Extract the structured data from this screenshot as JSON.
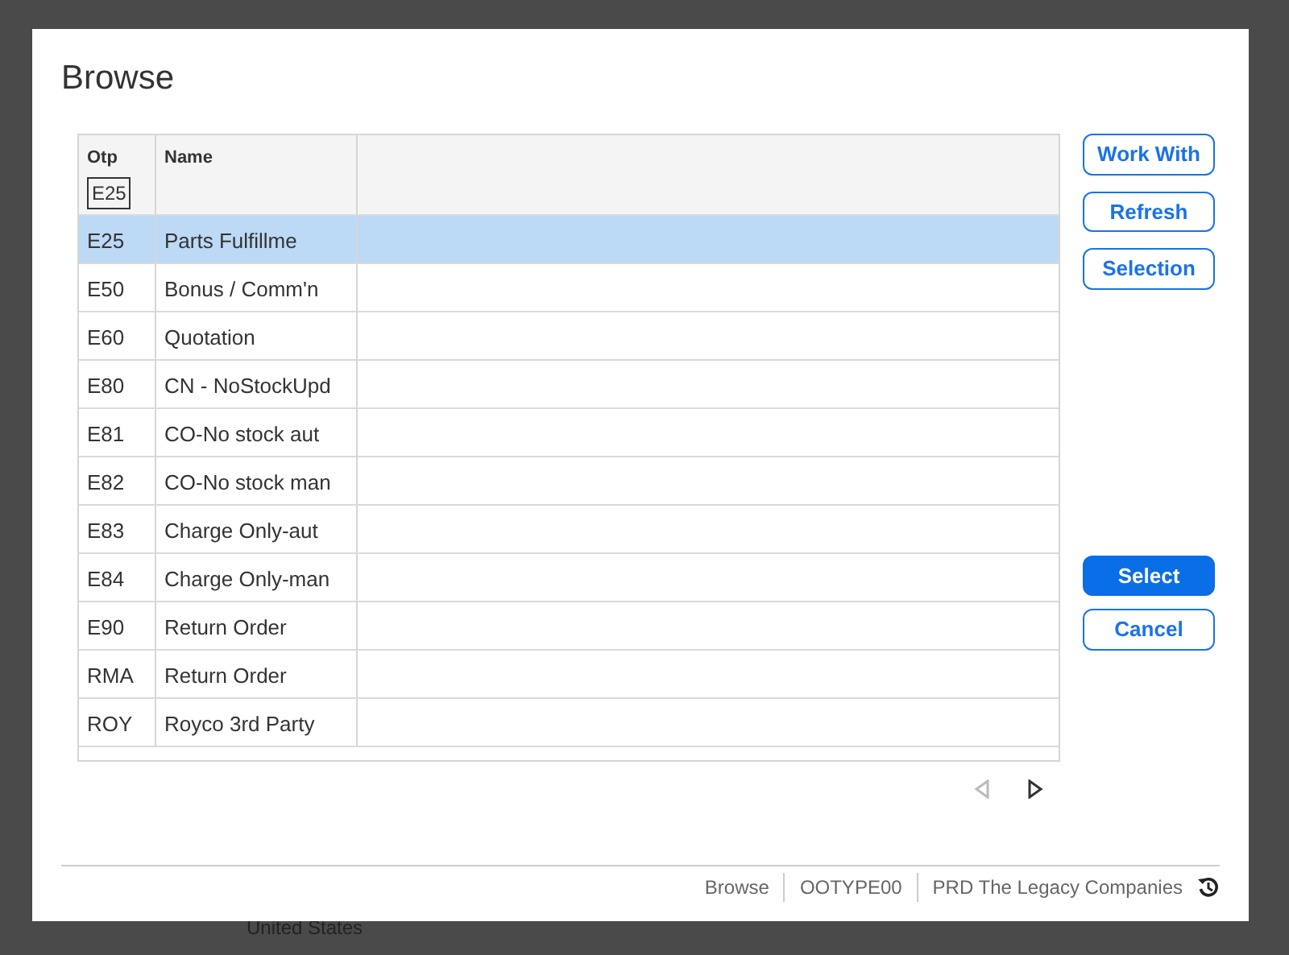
{
  "background_text": "United States",
  "dialog": {
    "title": "Browse"
  },
  "table": {
    "columns": [
      {
        "label": "Otp",
        "filter": "E25"
      },
      {
        "label": "Name"
      }
    ],
    "rows": [
      {
        "cells": [
          "E25",
          "Parts Fulfillme"
        ],
        "selected": true
      },
      {
        "cells": [
          "E50",
          "Bonus / Comm'n"
        ],
        "selected": false
      },
      {
        "cells": [
          "E60",
          "Quotation"
        ],
        "selected": false
      },
      {
        "cells": [
          "E80",
          "CN - NoStockUpd"
        ],
        "selected": false
      },
      {
        "cells": [
          "E81",
          "CO-No stock aut"
        ],
        "selected": false
      },
      {
        "cells": [
          "E82",
          "CO-No stock man"
        ],
        "selected": false
      },
      {
        "cells": [
          "E83",
          "Charge Only-aut"
        ],
        "selected": false
      },
      {
        "cells": [
          "E84",
          "Charge Only-man"
        ],
        "selected": false
      },
      {
        "cells": [
          "E90",
          "Return Order"
        ],
        "selected": false
      },
      {
        "cells": [
          "RMA",
          "Return Order"
        ],
        "selected": false
      },
      {
        "cells": [
          "ROY",
          "Royco 3rd Party"
        ],
        "selected": false
      }
    ]
  },
  "pager": {
    "previous_disabled": true,
    "next_disabled": false
  },
  "side_buttons": [
    {
      "label": "Work With",
      "primary": false
    },
    {
      "label": "Refresh",
      "primary": false
    },
    {
      "label": "Selection",
      "primary": false
    }
  ],
  "action_buttons": [
    {
      "label": "Select",
      "primary": true
    },
    {
      "label": "Cancel",
      "primary": false
    }
  ],
  "status_bar": [
    "Browse",
    "OOTYPE00",
    "PRD The Legacy Companies"
  ]
}
